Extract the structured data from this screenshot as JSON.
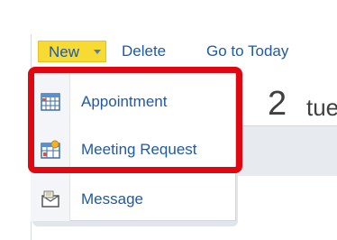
{
  "toolbar": {
    "new_label": "New",
    "delete_label": "Delete",
    "go_to_today_label": "Go to Today"
  },
  "date_header": {
    "day_number": "2",
    "day_text": "tue"
  },
  "new_menu": {
    "items": [
      {
        "label": "Appointment",
        "icon": "calendar-grid-icon"
      },
      {
        "label": "Meeting Request",
        "icon": "meeting-request-icon"
      },
      {
        "label": "Message",
        "icon": "envelope-message-icon"
      }
    ]
  },
  "colors": {
    "highlight": "#e10710",
    "new_button": "#f7da32",
    "link": "#1f5aa6"
  }
}
